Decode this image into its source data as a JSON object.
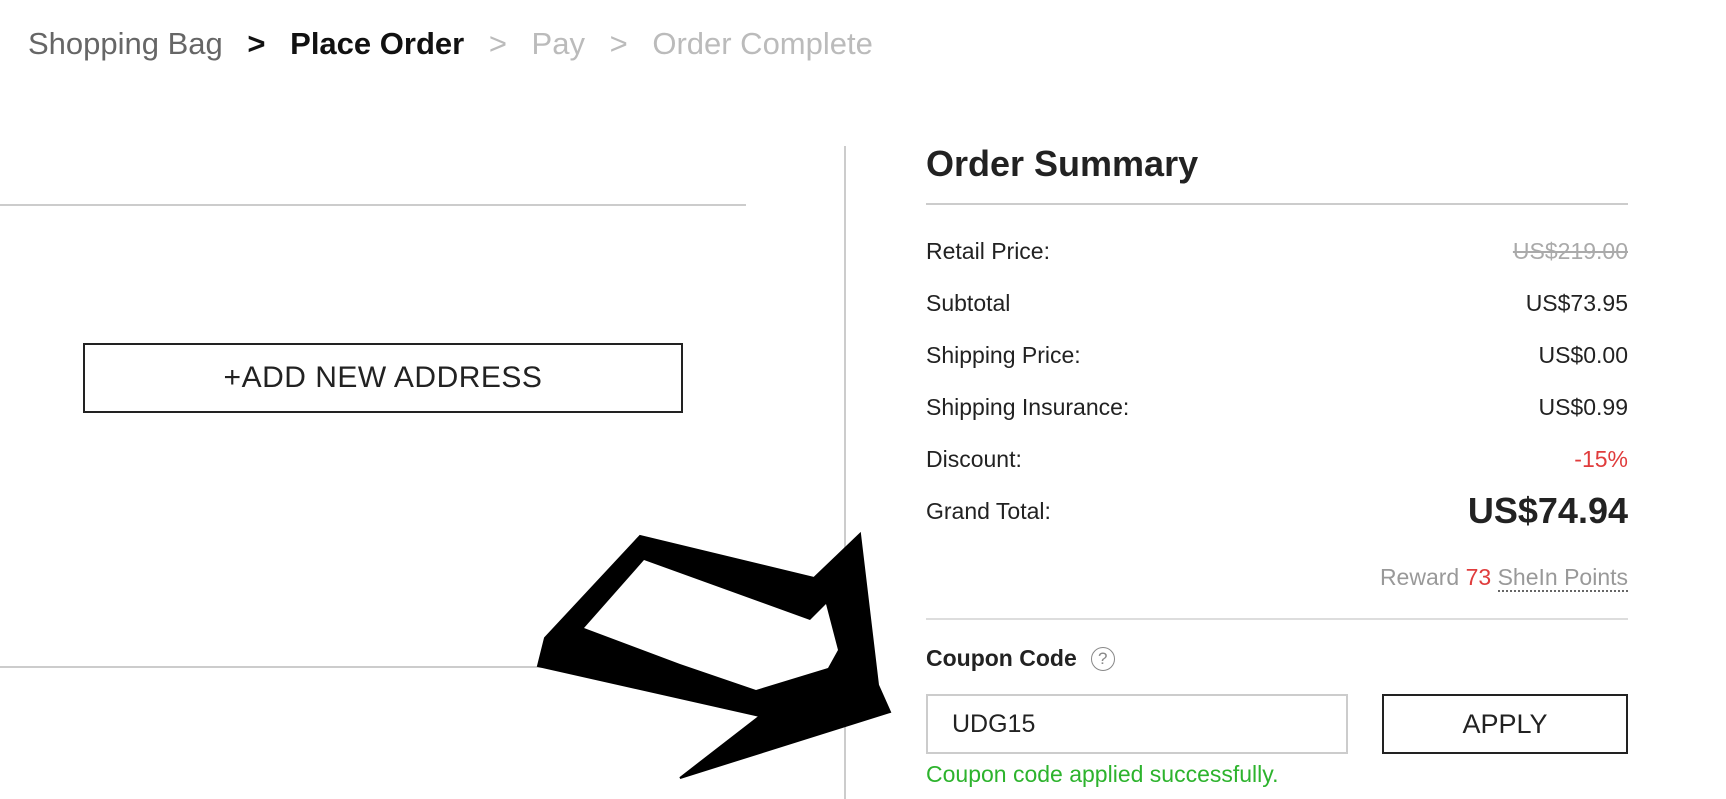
{
  "breadcrumb": {
    "steps": [
      "Shopping Bag",
      "Place Order",
      "Pay",
      "Order Complete"
    ],
    "separator": ">"
  },
  "address": {
    "add_label": "+ADD NEW ADDRESS"
  },
  "summary": {
    "title": "Order Summary",
    "rows": [
      {
        "label": "Retail Price:",
        "value": "US$219.00"
      },
      {
        "label": "Subtotal",
        "value": "US$73.95"
      },
      {
        "label": "Shipping Price:",
        "value": "US$0.00"
      },
      {
        "label": "Shipping Insurance:",
        "value": "US$0.99"
      },
      {
        "label": "Discount:",
        "value": "-15%"
      },
      {
        "label": "Grand Total:",
        "value": "US$74.94"
      }
    ],
    "reward": {
      "prefix": "Reward",
      "points": "73",
      "link": "SheIn Points"
    }
  },
  "coupon": {
    "label": "Coupon Code",
    "help_symbol": "?",
    "value": "UDG15",
    "apply_label": "APPLY",
    "success_message": "Coupon code applied successfully."
  },
  "colors": {
    "accent_red": "#e03c3c",
    "success_green": "#2db32d",
    "text_dark": "#222222",
    "text_muted": "#bbbbbb"
  },
  "icons": [
    "help-icon",
    "arrow-pointer-icon"
  ]
}
